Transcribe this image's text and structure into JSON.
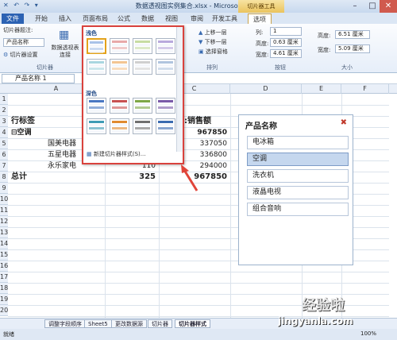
{
  "window": {
    "title": "数据透视图实例集合.xlsx - Microsoft Excel",
    "context_tab": "切片器工具"
  },
  "tabs": [
    "开始",
    "插入",
    "页面布局",
    "公式",
    "数据",
    "视图",
    "审阅",
    "开发工具",
    "选项"
  ],
  "file_tab": "文件",
  "ribbon": {
    "slicer_title_label": "切片器题注:",
    "slicer_caption": "产品名称",
    "slicer_settings": "切片器设置",
    "slicer_group": "切片器",
    "report_conn": "数据透视表连接",
    "bring_forward": "上移一层",
    "send_backward": "下移一层",
    "selection_pane": "选择窗格",
    "arrange_group": "排列",
    "columns_label": "列:",
    "columns_value": "1",
    "height_label": "高度:",
    "height_value": "0.63 厘米",
    "width_label": "宽度:",
    "width_value": "4.61 厘米",
    "buttons_group": "按钮",
    "size_height_label": "高度:",
    "size_height_value": "6.51 厘米",
    "size_width_label": "宽度:",
    "size_width_value": "5.09 厘米",
    "size_group": "大小"
  },
  "gallery": {
    "light_label": "浅色",
    "dark_label": "深色",
    "new_style": "新建切片器样式(S)..."
  },
  "formula_bar": {
    "name_box": "产品名称 1",
    "fx": "fx"
  },
  "columns": [
    "A",
    "B",
    "C",
    "D",
    "E",
    "F"
  ],
  "rows": [
    "1",
    "2",
    "3",
    "4",
    "5",
    "6",
    "7",
    "8",
    "9",
    "10",
    "11",
    "12",
    "13",
    "14",
    "15",
    "16",
    "17",
    "18",
    "19",
    "20"
  ],
  "pivot": {
    "row_label": "行标签",
    "sum_label": ":销售额",
    "r4": {
      "label": "⊟空调",
      "value": "967850"
    },
    "r5": {
      "label": "国美电器",
      "value": "337050"
    },
    "r6": {
      "label": "五星电器",
      "value": "336800"
    },
    "r7": {
      "label": "永乐家电",
      "qty": "110",
      "value": "294000"
    },
    "r8": {
      "label": "总计",
      "qty": "325",
      "value": "967850"
    }
  },
  "slicer": {
    "title": "产品名称",
    "items": [
      "电冰箱",
      "空调",
      "洗衣机",
      "液晶电视",
      "组合音响"
    ],
    "selected": "空调"
  },
  "sheet_tabs": [
    "调整字段顺序",
    "Sheet5",
    "更改数据源",
    "切片器",
    "切片器样式"
  ],
  "active_sheet": "切片器样式",
  "status": "就绪",
  "zoom": "100%",
  "watermark": {
    "line1": "经验啦",
    "line2": "jingyanla.com"
  }
}
